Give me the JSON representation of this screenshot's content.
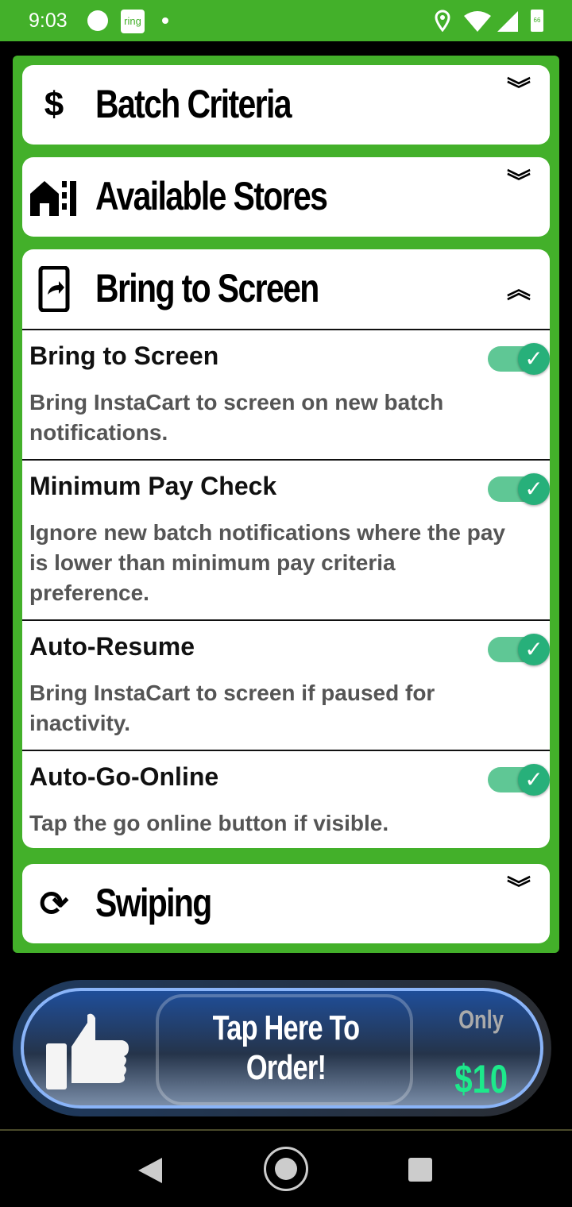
{
  "status_bar": {
    "time": "9:03",
    "ring_label": "ring",
    "battery": "66"
  },
  "sections": [
    {
      "title": "Batch Criteria",
      "icon": "dollar-icon",
      "expanded": false
    },
    {
      "title": "Available Stores",
      "icon": "store-icon",
      "expanded": false
    },
    {
      "title": "Bring to Screen",
      "icon": "phone-share-icon",
      "expanded": true,
      "settings": [
        {
          "label": "Bring to Screen",
          "description": "Bring InstaCart to screen on new batch notifications.",
          "enabled": true
        },
        {
          "label": "Minimum Pay Check",
          "description": "Ignore new batch notifications where the pay is lower than minimum pay criteria preference.",
          "enabled": true
        },
        {
          "label": "Auto-Resume",
          "description": "Bring InstaCart to screen if paused for inactivity.",
          "enabled": true
        },
        {
          "label": "Auto-Go-Online",
          "description": "Tap the go online button if visible.",
          "enabled": true
        }
      ]
    },
    {
      "title": "Swiping",
      "icon": "sync-icon",
      "expanded": false
    }
  ],
  "ad": {
    "cta": "Tap Here To Order!",
    "only": "Only",
    "price": "$10"
  },
  "icons": {
    "dollar": "$",
    "chev_down": "︾",
    "chev_up": "︽",
    "check": "✓",
    "sync": "⟳"
  }
}
